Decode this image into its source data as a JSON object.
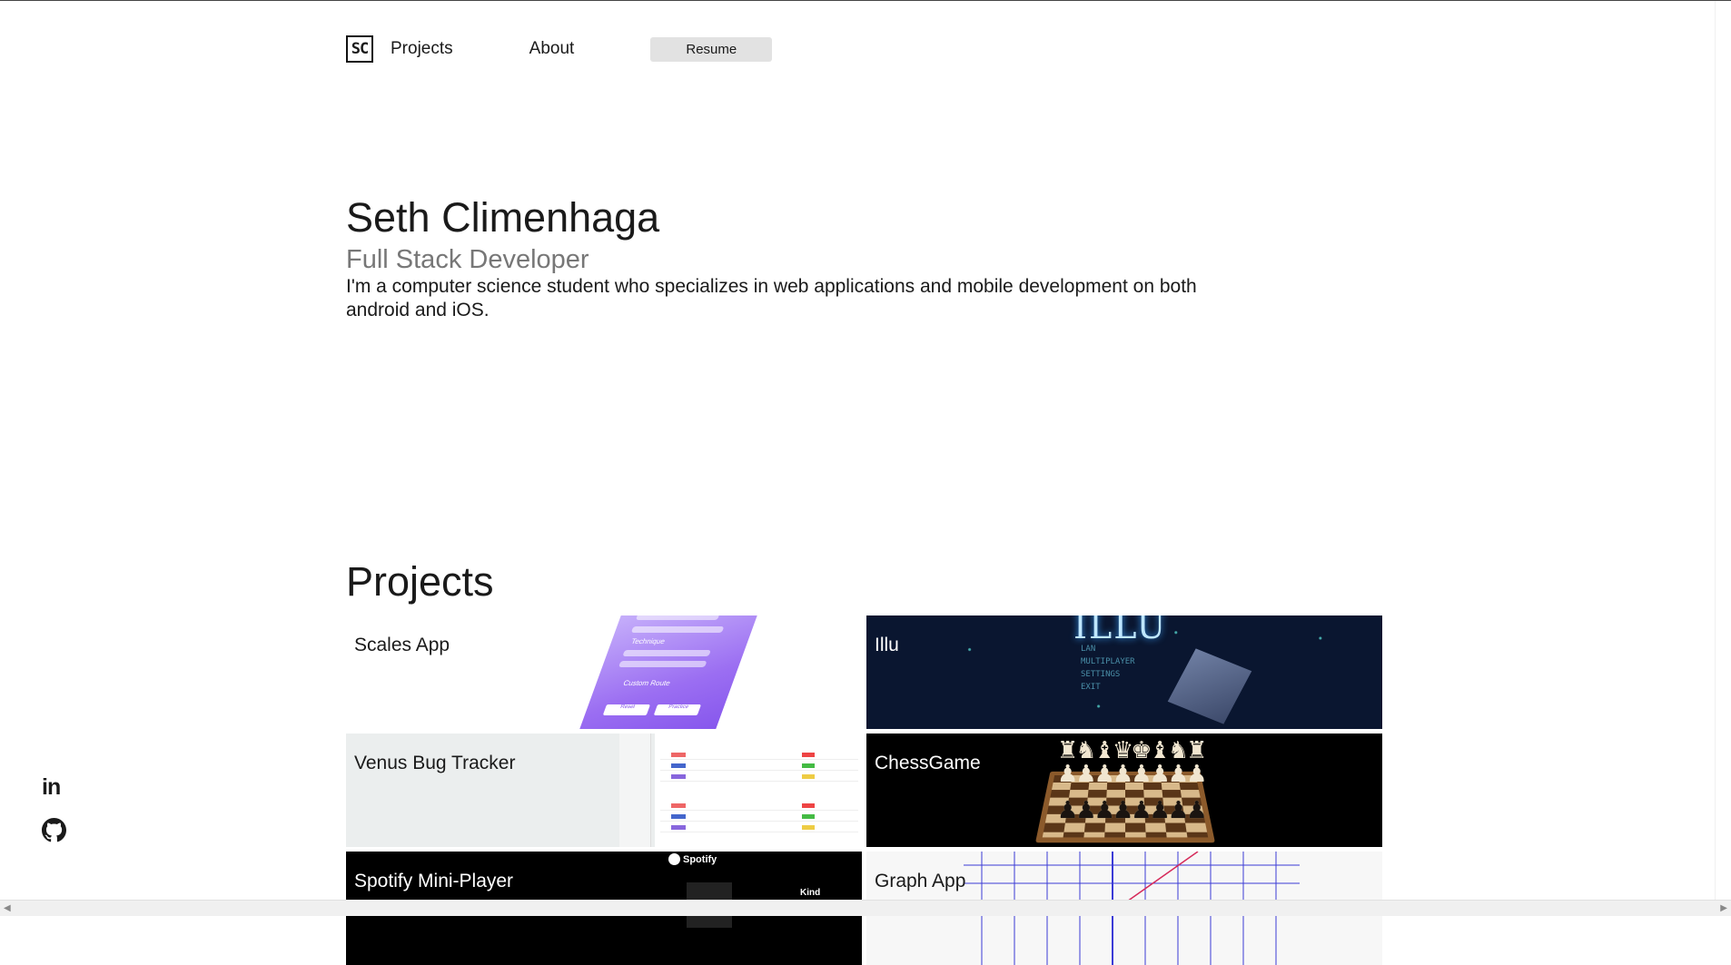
{
  "nav": {
    "logo_text": "SC",
    "projects_label": "Projects",
    "about_label": "About",
    "resume_label": "Resume"
  },
  "hero": {
    "name": "Seth Climenhaga",
    "role": "Full Stack Developer",
    "bio": "I'm a computer science student who specializes in web applications and mobile development on both android and iOS."
  },
  "projects": {
    "heading": "Projects",
    "items": [
      {
        "title": "Scales App"
      },
      {
        "title": "Illu"
      },
      {
        "title": "Venus Bug Tracker"
      },
      {
        "title": "ChessGame"
      },
      {
        "title": "Spotify Mini-Player"
      },
      {
        "title": "Graph App"
      }
    ],
    "illu_screen": {
      "title": "ILLU",
      "menu": [
        "LAN",
        "MULTIPLAYER",
        "SETTINGS",
        "EXIT"
      ]
    },
    "spotify_screen": {
      "brand": "Spotify",
      "track": "Kind"
    },
    "scales_screen": {
      "section": "Technique",
      "route_label": "Custom Route",
      "btn1": "Reset",
      "btn2": "Practice"
    }
  },
  "social": {
    "linkedin_icon": "linkedin-icon",
    "github_icon": "github-icon"
  },
  "colors": {
    "illu_bg": "#0a1630",
    "venus_bg": "#ebeeee",
    "scales_purple": "#9b6ef2"
  }
}
